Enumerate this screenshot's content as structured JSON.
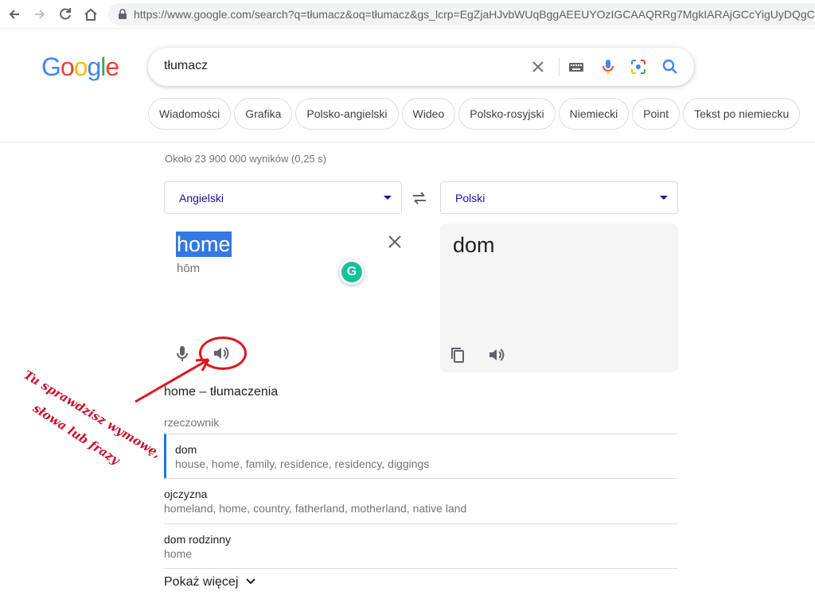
{
  "browser": {
    "url": "https://www.google.com/search?q=tłumacz&oq=tłumacz&gs_lcrp=EgZjaHJvbWUqBggAEEUYOzIGCAAQRRg7MgkIARAjGCcYigUyDQgCEAA"
  },
  "logo": {
    "letters": [
      "G",
      "o",
      "o",
      "g",
      "l",
      "e"
    ],
    "colors": [
      "#4285f4",
      "#ea4335",
      "#fbbc05",
      "#4285f4",
      "#34a853",
      "#ea4335"
    ]
  },
  "search": {
    "query": "tłumacz"
  },
  "chips": [
    "Wiadomości",
    "Grafika",
    "Polsko-angielski",
    "Wideo",
    "Polsko-rosyjski",
    "Niemiecki",
    "Point",
    "Tekst po niemiecku"
  ],
  "stats": "Około 23 900 000 wyników (0,25 s)",
  "translator": {
    "source_lang": "Angielski",
    "target_lang": "Polski",
    "source_text": "home",
    "source_phonetic": "hōm",
    "target_text": "dom"
  },
  "annotation": {
    "lines": [
      "Tu sprawdzisz wymowę,",
      "słowa lub frazy"
    ],
    "color": "#c8102e"
  },
  "translations": {
    "heading": "home – tłumaczenia",
    "part_of_speech": "rzeczownik",
    "rows": [
      {
        "word": "dom",
        "synonyms": "house, home, family, residence, residency, diggings",
        "selected": true
      },
      {
        "word": "ojczyzna",
        "synonyms": "homeland, home, country, fatherland, motherland, native land",
        "selected": false
      },
      {
        "word": "dom rodzinny",
        "synonyms": "home",
        "selected": false
      }
    ],
    "show_more": "Pokaż więcej"
  }
}
